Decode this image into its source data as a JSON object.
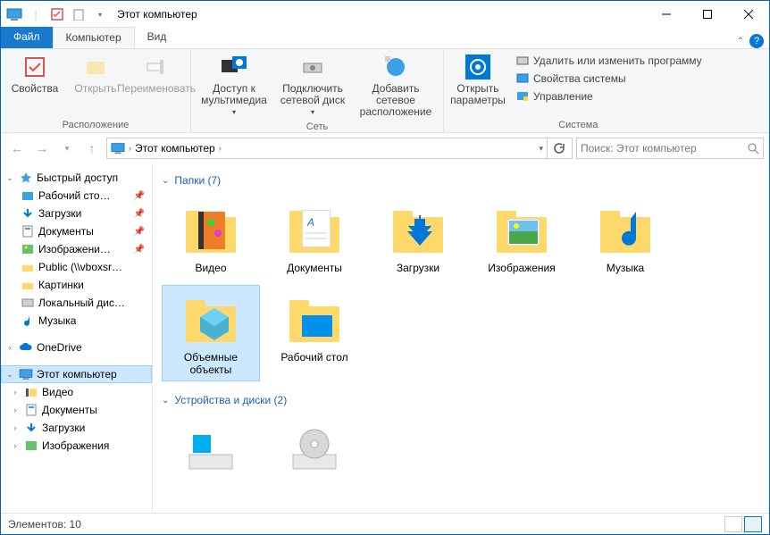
{
  "title": "Этот компьютер",
  "tabs": {
    "file": "Файл",
    "computer": "Компьютер",
    "view": "Вид"
  },
  "ribbon": {
    "groups": {
      "location": {
        "label": "Расположение",
        "properties": "Свойства",
        "open": "Открыть",
        "rename": "Переименовать"
      },
      "network": {
        "label": "Сеть",
        "media": "Доступ к мультимедиа",
        "netdrive": "Подключить сетевой диск",
        "netloc": "Добавить сетевое расположение"
      },
      "system": {
        "label": "Система",
        "settings": "Открыть параметры",
        "uninstall": "Удалить или изменить программу",
        "sysprops": "Свойства системы",
        "manage": "Управление"
      }
    }
  },
  "breadcrumb": {
    "root": "Этот компьютер"
  },
  "search_placeholder": "Поиск: Этот компьютер",
  "tree": {
    "quick": "Быстрый доступ",
    "quick_items": [
      "Рабочий сто…",
      "Загрузки",
      "Документы",
      "Изображени…",
      "Public (\\\\vboxsr…",
      "Картинки",
      "Локальный дис…",
      "Музыка"
    ],
    "onedrive": "OneDrive",
    "thispc": "Этот компьютер",
    "thispc_items": [
      "Видео",
      "Документы",
      "Загрузки",
      "Изображения"
    ]
  },
  "content": {
    "folders_header": "Папки (7)",
    "devices_header": "Устройства и диски (2)",
    "folders": [
      "Видео",
      "Документы",
      "Загрузки",
      "Изображения",
      "Музыка",
      "Объемные объекты",
      "Рабочий стол"
    ],
    "selected_index": 5
  },
  "status": {
    "count_label": "Элементов: 10"
  }
}
